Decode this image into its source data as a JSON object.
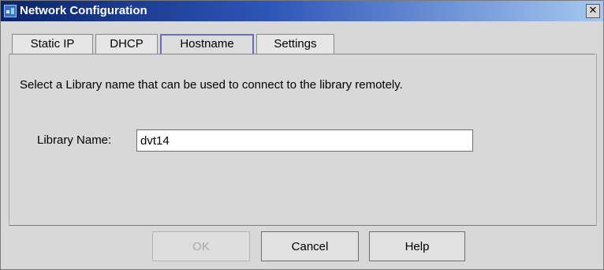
{
  "window": {
    "title": "Network Configuration",
    "close_glyph": "✕"
  },
  "tabs": [
    {
      "label": "Static IP",
      "active": false
    },
    {
      "label": "DHCP",
      "active": false
    },
    {
      "label": "Hostname",
      "active": true
    },
    {
      "label": "Settings",
      "active": false
    }
  ],
  "content": {
    "instruction": "Select a Library name that can be used to connect to the library remotely.",
    "library_name_label": "Library Name:",
    "library_name_value": "dvt14"
  },
  "buttons": {
    "ok": "OK",
    "cancel": "Cancel",
    "help": "Help"
  },
  "colors": {
    "title_gradient_start": "#0a246a",
    "title_gradient_end": "#a6c8f0",
    "active_tab_border": "#6b6bbf"
  },
  "icons": {
    "app": "network-config-icon",
    "close": "close-icon"
  }
}
